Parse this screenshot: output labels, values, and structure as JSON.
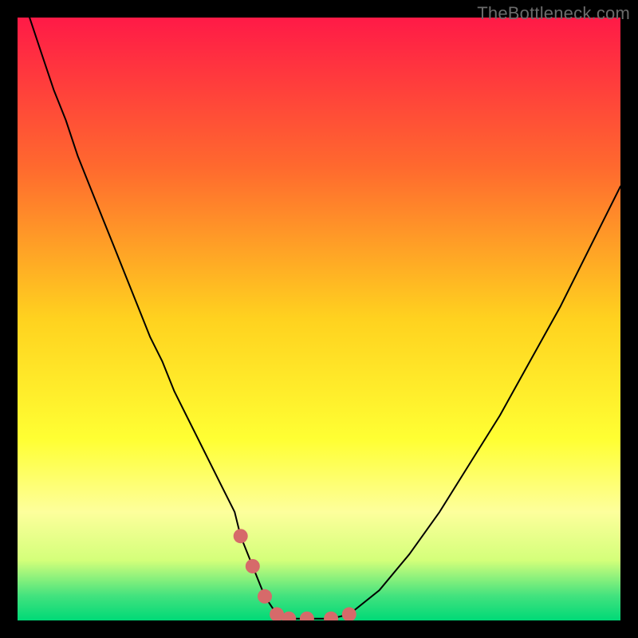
{
  "watermark": "TheBottleneck.com",
  "chart_data": {
    "type": "line",
    "title": "",
    "xlabel": "",
    "ylabel": "",
    "xlim": [
      0,
      100
    ],
    "ylim": [
      0,
      100
    ],
    "grid": false,
    "legend": false,
    "background_gradient": {
      "stops": [
        {
          "offset": 0.0,
          "color": "#ff1a47"
        },
        {
          "offset": 0.25,
          "color": "#ff6a2e"
        },
        {
          "offset": 0.5,
          "color": "#ffd21f"
        },
        {
          "offset": 0.7,
          "color": "#ffff33"
        },
        {
          "offset": 0.82,
          "color": "#fdff9c"
        },
        {
          "offset": 0.9,
          "color": "#d4ff7a"
        },
        {
          "offset": 0.96,
          "color": "#41e27e"
        },
        {
          "offset": 1.0,
          "color": "#00d977"
        }
      ]
    },
    "series": [
      {
        "name": "bottleneck-curve",
        "stroke": "#000000",
        "stroke_width": 2,
        "x": [
          2,
          4,
          6,
          8,
          10,
          12,
          14,
          16,
          18,
          20,
          22,
          24,
          26,
          28,
          30,
          32,
          34,
          36,
          37,
          39,
          41,
          43,
          45,
          48,
          52,
          55,
          60,
          65,
          70,
          75,
          80,
          85,
          90,
          95,
          100
        ],
        "y": [
          100,
          94,
          88,
          83,
          77,
          72,
          67,
          62,
          57,
          52,
          47,
          43,
          38,
          34,
          30,
          26,
          22,
          18,
          14,
          9,
          4,
          1,
          0.3,
          0.3,
          0.3,
          1,
          5,
          11,
          18,
          26,
          34,
          43,
          52,
          62,
          72
        ]
      },
      {
        "name": "highlighted-points",
        "type": "scatter",
        "marker_color": "#d66a6a",
        "marker_radius": 9,
        "x": [
          37,
          39,
          41,
          43,
          45,
          48,
          52,
          55
        ],
        "y": [
          14,
          9,
          4,
          1,
          0.3,
          0.3,
          0.3,
          1
        ]
      }
    ]
  }
}
